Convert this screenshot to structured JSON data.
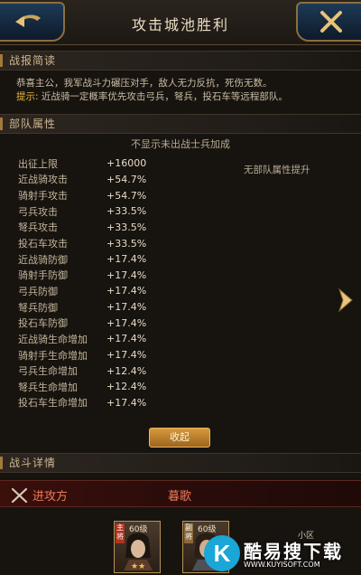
{
  "header": {
    "title": "攻击城池胜利"
  },
  "summary": {
    "section_title": "战报简读",
    "message": "恭喜主公，我军战斗力碾压对手，敌人无力反抗，死伤无数。",
    "hint_label": "提示:",
    "hint_text": "近战骑一定概率优先攻击弓兵，弩兵，投石车等远程部队。"
  },
  "attributes": {
    "section_title": "部队属性",
    "no_show_note": "不显示未出战士兵加成",
    "no_bonus_note": "无部队属性提升",
    "rows": [
      {
        "name": "出征上限",
        "value": "+16000"
      },
      {
        "name": "近战骑攻击",
        "value": "+54.7%"
      },
      {
        "name": "骑射手攻击",
        "value": "+54.7%"
      },
      {
        "name": "弓兵攻击",
        "value": "+33.5%"
      },
      {
        "name": "弩兵攻击",
        "value": "+33.5%"
      },
      {
        "name": "投石车攻击",
        "value": "+33.5%"
      },
      {
        "name": "近战骑防御",
        "value": "+17.4%"
      },
      {
        "name": "骑射手防御",
        "value": "+17.4%"
      },
      {
        "name": "弓兵防御",
        "value": "+17.4%"
      },
      {
        "name": "弩兵防御",
        "value": "+17.4%"
      },
      {
        "name": "投石车防御",
        "value": "+17.4%"
      },
      {
        "name": "近战骑生命增加",
        "value": "+17.4%"
      },
      {
        "name": "骑射手生命增加",
        "value": "+17.4%"
      },
      {
        "name": "弓兵生命增加",
        "value": "+12.4%"
      },
      {
        "name": "弩兵生命增加",
        "value": "+12.4%"
      },
      {
        "name": "投石车生命增加",
        "value": "+17.4%"
      }
    ],
    "collapse_label": "收起"
  },
  "battle": {
    "section_title": "战斗详情",
    "attacker_label": "进攻方",
    "defender_name": "暮歌",
    "cards": [
      {
        "level": "60级",
        "role": "主将",
        "stars": "★★"
      },
      {
        "level": "60级",
        "role": "副将",
        "stars": ""
      }
    ],
    "small_tag": "小区"
  },
  "watermark": {
    "logo_letter": "K",
    "text": "酷易搜下载",
    "url": "WWW.KUYISOFT.COM"
  },
  "colors": {
    "accent_gold": "#d79a3b",
    "hint_yellow": "#e8b83c",
    "team_red": "#ef7a5a",
    "background": "#17130f"
  },
  "icons": {
    "back": "back-arrow-icon",
    "close": "close-x-icon",
    "next": "chevron-right-icon",
    "attacker": "crossed-swords-icon"
  }
}
